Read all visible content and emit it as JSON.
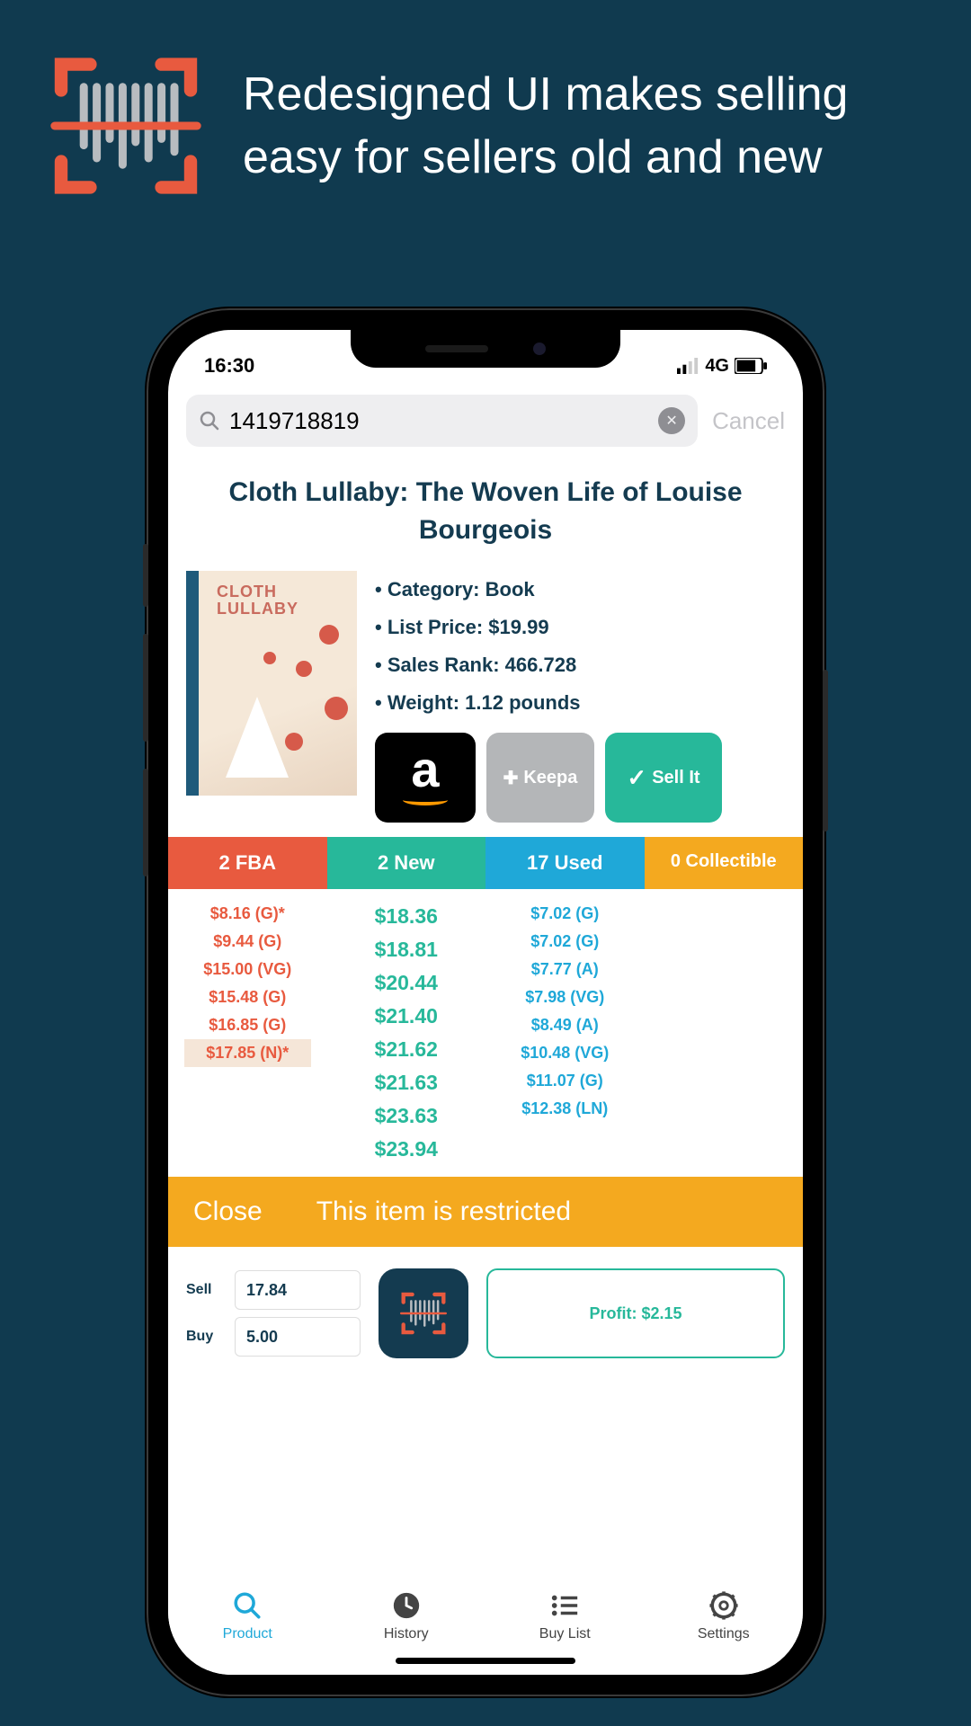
{
  "hero": {
    "text": "Redesigned UI makes selling easy for sellers old and new"
  },
  "status": {
    "time": "16:30",
    "network": "4G"
  },
  "search": {
    "value": "1419718819",
    "cancel": "Cancel"
  },
  "product": {
    "title": "Cloth Lullaby: The Woven Life of Louise Bourgeois",
    "cover_title1": "CLOTH",
    "cover_title2": "LULLABY",
    "category_label": "Category: Book",
    "list_price_label": "List Price: $19.99",
    "sales_rank_label": "Sales Rank: 466.728",
    "weight_label": "Weight: 1.12 pounds"
  },
  "actions": {
    "keepa": "Keepa",
    "keepa_plus": "✚",
    "sellit": "Sell It"
  },
  "tabs": {
    "fba": "2 FBA",
    "new": "2 New",
    "used": "17 Used",
    "collectible": "0 Collectible"
  },
  "prices": {
    "fba": [
      "$8.16 (G)*",
      "$9.44 (G)",
      "$15.00 (VG)",
      "$15.48 (G)",
      "$16.85 (G)",
      "$17.85 (N)*"
    ],
    "new": [
      "$18.36",
      "$18.81",
      "$20.44",
      "$21.40",
      "$21.62",
      "$21.63",
      "$23.63",
      "$23.94"
    ],
    "used": [
      "$7.02 (G)",
      "$7.02 (G)",
      "$7.77 (A)",
      "$7.98 (VG)",
      "$8.49 (A)",
      "$10.48 (VG)",
      "$11.07 (G)",
      "$12.38 (LN)"
    ]
  },
  "restrict": {
    "close": "Close",
    "msg": "This item is restricted"
  },
  "sellbuy": {
    "sell_label": "Sell",
    "sell_value": "17.84",
    "buy_label": "Buy",
    "buy_value": "5.00"
  },
  "profit": {
    "text": "Profit: $2.15"
  },
  "tabbar": {
    "product": "Product",
    "history": "History",
    "buylist": "Buy List",
    "settings": "Settings"
  }
}
